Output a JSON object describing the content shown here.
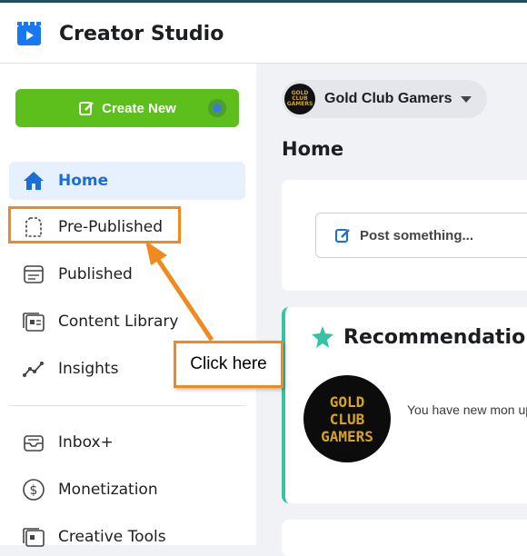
{
  "app": {
    "title": "Creator Studio"
  },
  "sidebar": {
    "create_label": "Create New",
    "items": [
      {
        "label": "Home",
        "icon": "home-icon",
        "active": true
      },
      {
        "label": "Pre-Published",
        "icon": "draft-page-icon",
        "active": false
      },
      {
        "label": "Published",
        "icon": "published-icon",
        "active": false
      },
      {
        "label": "Content Library",
        "icon": "content-library-icon",
        "active": false
      },
      {
        "label": "Insights",
        "icon": "insights-icon",
        "active": false
      },
      {
        "label": "Inbox+",
        "icon": "inbox-icon",
        "active": false
      },
      {
        "label": "Monetization",
        "icon": "dollar-icon",
        "active": false
      },
      {
        "label": "Creative Tools",
        "icon": "creative-tools-icon",
        "active": false
      }
    ]
  },
  "main": {
    "page_name": "Gold Club Gamers",
    "avatar_text": "GOLD CLUB GAMERS",
    "home_title": "Home",
    "post_placeholder": "Post something...",
    "recommendations_title": "Recommendations",
    "recommendation_text": "You have new mon up.",
    "avatar_lines": [
      "GOLD",
      "CLUB",
      "GAMERS"
    ]
  },
  "annotation": {
    "callout_text": "Click here"
  },
  "colors": {
    "accent": "#1a6ed8",
    "create_green": "#5cbf1c",
    "highlight_orange": "#f08a1c",
    "teal": "#36c2a5"
  }
}
